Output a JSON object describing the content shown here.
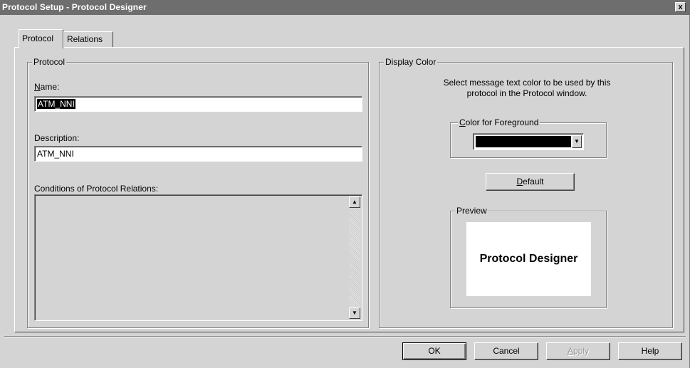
{
  "window": {
    "title": "Protocol Setup - Protocol Designer",
    "close_glyph": "x"
  },
  "tabs": [
    {
      "label": "Protocol",
      "active": true
    },
    {
      "label": "Relations",
      "active": false
    }
  ],
  "protocol_group": {
    "legend": "Protocol",
    "name_label_mnemonic": "N",
    "name_label_rest": "ame:",
    "name_value": "ATM_NNI",
    "description_label": "Description:",
    "description_value": "ATM_NNI",
    "conditions_label": "Conditions of Protocol Relations:"
  },
  "display_color_group": {
    "legend": "Display Color",
    "instruction_line1": "Select message text color to be used by this",
    "instruction_line2": "protocol in the Protocol window.",
    "foreground_legend_mnemonic": "C",
    "foreground_legend_rest": "olor for Foreground",
    "foreground_color": "#000000",
    "default_button_mnemonic": "D",
    "default_button_rest": "efault",
    "preview_legend": "Preview",
    "preview_text": "Protocol Designer"
  },
  "footer_buttons": {
    "ok": "OK",
    "cancel": "Cancel",
    "apply_mnemonic": "A",
    "apply_rest": "pply",
    "help": "Help"
  },
  "colors": {
    "titlebar": "#6e6e6e",
    "face": "#d4d4d4"
  },
  "icons": {
    "close": "close-icon",
    "scroll_up": "scroll-up-arrow-icon",
    "scroll_down": "scroll-down-arrow-icon",
    "dropdown": "chevron-down-icon"
  }
}
